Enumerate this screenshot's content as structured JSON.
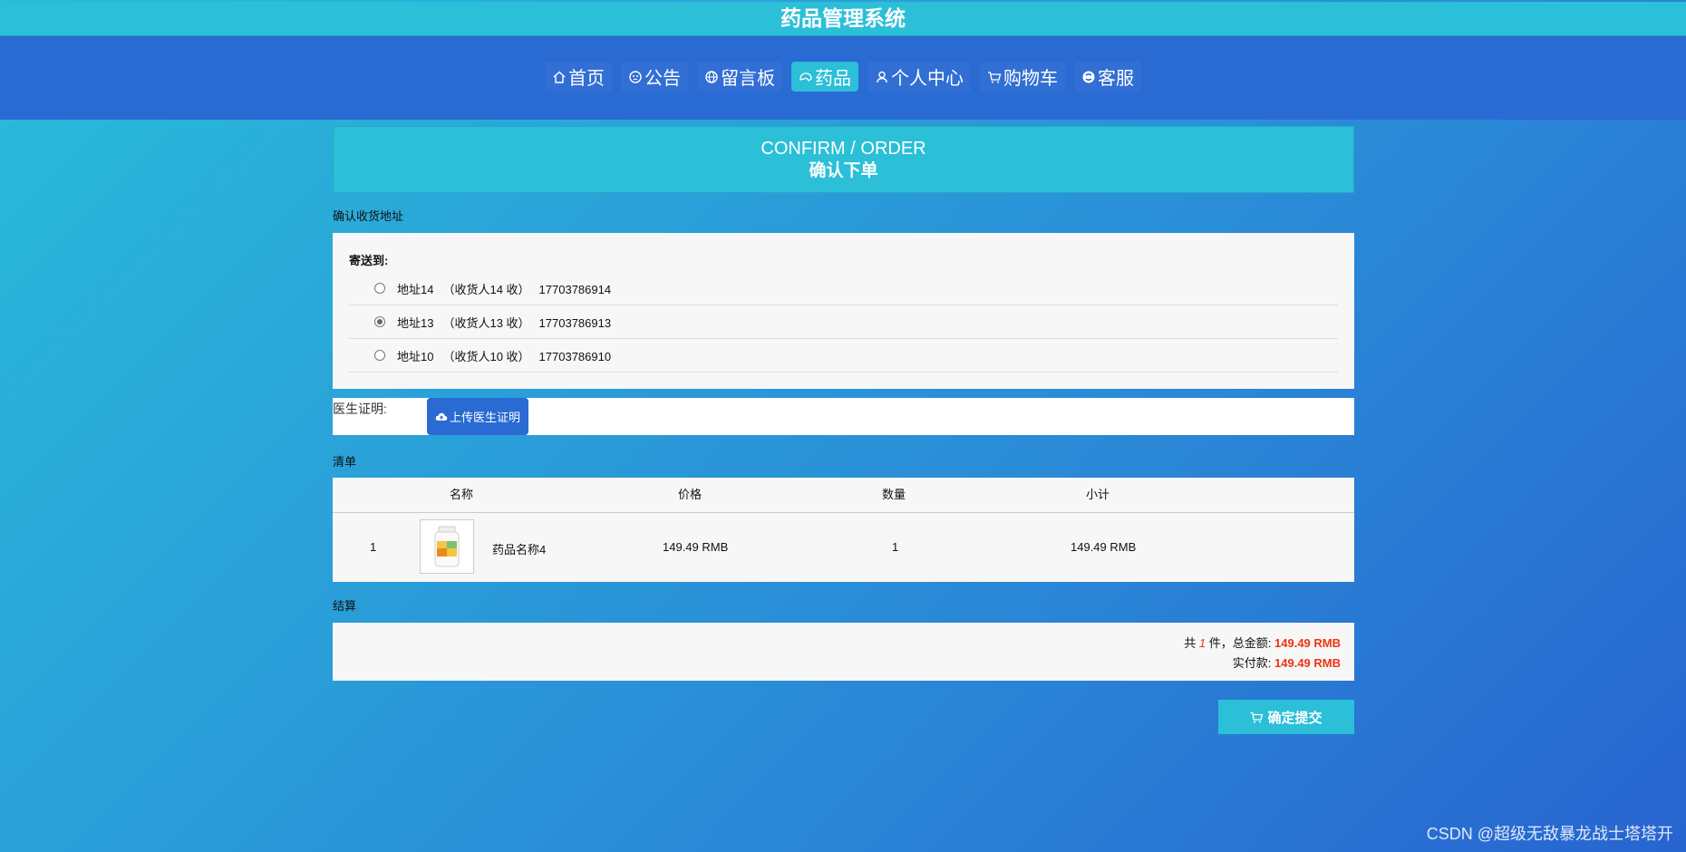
{
  "app": {
    "title": "药品管理系统"
  },
  "nav": {
    "items": [
      {
        "label": "首页",
        "icon": "home-icon"
      },
      {
        "label": "公告",
        "icon": "notice-icon"
      },
      {
        "label": "留言板",
        "icon": "globe-icon"
      },
      {
        "label": "药品",
        "icon": "medicine-icon",
        "active": true
      },
      {
        "label": "个人中心",
        "icon": "user-icon"
      },
      {
        "label": "购物车",
        "icon": "cart-icon"
      },
      {
        "label": "客服",
        "icon": "service-icon"
      }
    ]
  },
  "order": {
    "title_en": "CONFIRM / ORDER",
    "title_cn": "确认下单"
  },
  "address": {
    "section_label": "确认收货地址",
    "send_to_label": "寄送到:",
    "options": [
      {
        "addr": "地址14",
        "receiver": "（收货人14 收）",
        "phone": "17703786914",
        "checked": false
      },
      {
        "addr": "地址13",
        "receiver": "（收货人13 收）",
        "phone": "17703786913",
        "checked": true
      },
      {
        "addr": "地址10",
        "receiver": "（收货人10 收）",
        "phone": "17703786910",
        "checked": false
      }
    ]
  },
  "certificate": {
    "label": "医生证明:",
    "upload_button": "上传医生证明"
  },
  "list": {
    "section_label": "清单",
    "headers": [
      "名称",
      "价格",
      "数量",
      "小计"
    ],
    "rows": [
      {
        "index": "1",
        "name": "药品名称4",
        "price": "149.49 RMB",
        "qty": "1",
        "subtotal": "149.49 RMB"
      }
    ]
  },
  "settlement": {
    "section_label": "结算",
    "count_prefix": "共",
    "count": "1",
    "count_suffix": "件，总金额:",
    "total": "149.49 RMB",
    "paid_label": "实付款:",
    "paid": "149.49 RMB"
  },
  "submit": {
    "label": "确定提交"
  },
  "watermark": "CSDN @超级无敌暴龙战士塔塔开",
  "colors": {
    "teal": "#2bbfd8",
    "blue": "#2a6ad3",
    "accent_red": "#ee3311"
  }
}
